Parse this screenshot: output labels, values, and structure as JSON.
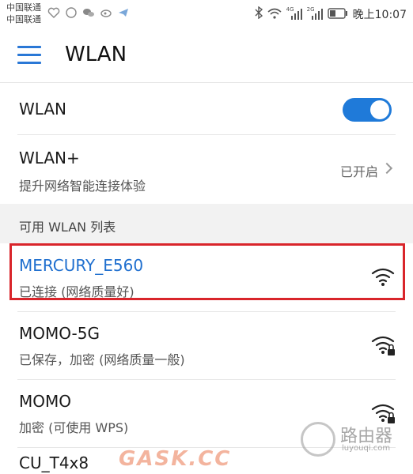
{
  "status_bar": {
    "carrier1": "中国联通",
    "carrier2": "中国联通",
    "network_labels": [
      "4G",
      "2G"
    ],
    "time": "晚上10:07"
  },
  "header": {
    "title": "WLAN"
  },
  "wlan_toggle": {
    "label": "WLAN",
    "on": true
  },
  "wlan_plus": {
    "label": "WLAN+",
    "subtitle": "提升网络智能连接体验",
    "value": "已开启"
  },
  "list_header": "可用 WLAN 列表",
  "networks": [
    {
      "name": "MERCURY_E560",
      "status": "已连接 (网络质量好)",
      "locked": false,
      "connected": true
    },
    {
      "name": "MOMO-5G",
      "status": "已保存，加密 (网络质量一般)",
      "locked": true,
      "connected": false
    },
    {
      "name": "MOMO",
      "status": "加密 (可使用 WPS)",
      "locked": true,
      "connected": false
    },
    {
      "name": "CU_T4x8",
      "status": "",
      "locked": false,
      "connected": false
    }
  ],
  "watermark": {
    "text": "GASK.CC",
    "logo_title": "路由器",
    "logo_sub": "luyouqi.com"
  },
  "colors": {
    "accent": "#1f7ad9",
    "connected_text": "#1f6fcf",
    "highlight_border": "#d9252b",
    "section_bg": "#f2f2f2"
  }
}
